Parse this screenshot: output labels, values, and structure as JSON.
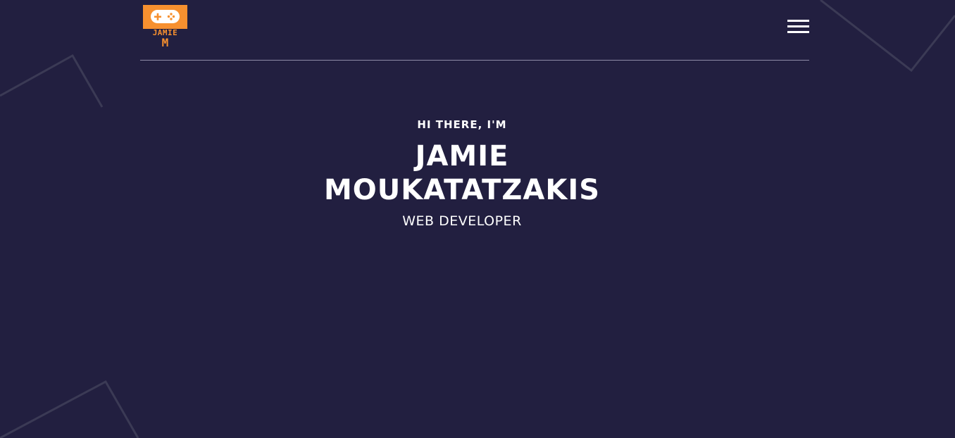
{
  "header": {
    "logo": {
      "name": "JAMIE",
      "initial": "M",
      "icon": "gamepad-icon",
      "color": "#f7902f"
    },
    "menu": {
      "icon": "hamburger-menu-icon"
    }
  },
  "hero": {
    "greeting": "HI THERE, I'M",
    "name_line1": "JAMIE",
    "name_line2": "MOUKATATZAKIS",
    "role": "WEB DEVELOPER"
  },
  "colors": {
    "background": "#221f40",
    "accent": "#f7902f",
    "text": "#ffffff",
    "divider": "#8f8ca8"
  }
}
